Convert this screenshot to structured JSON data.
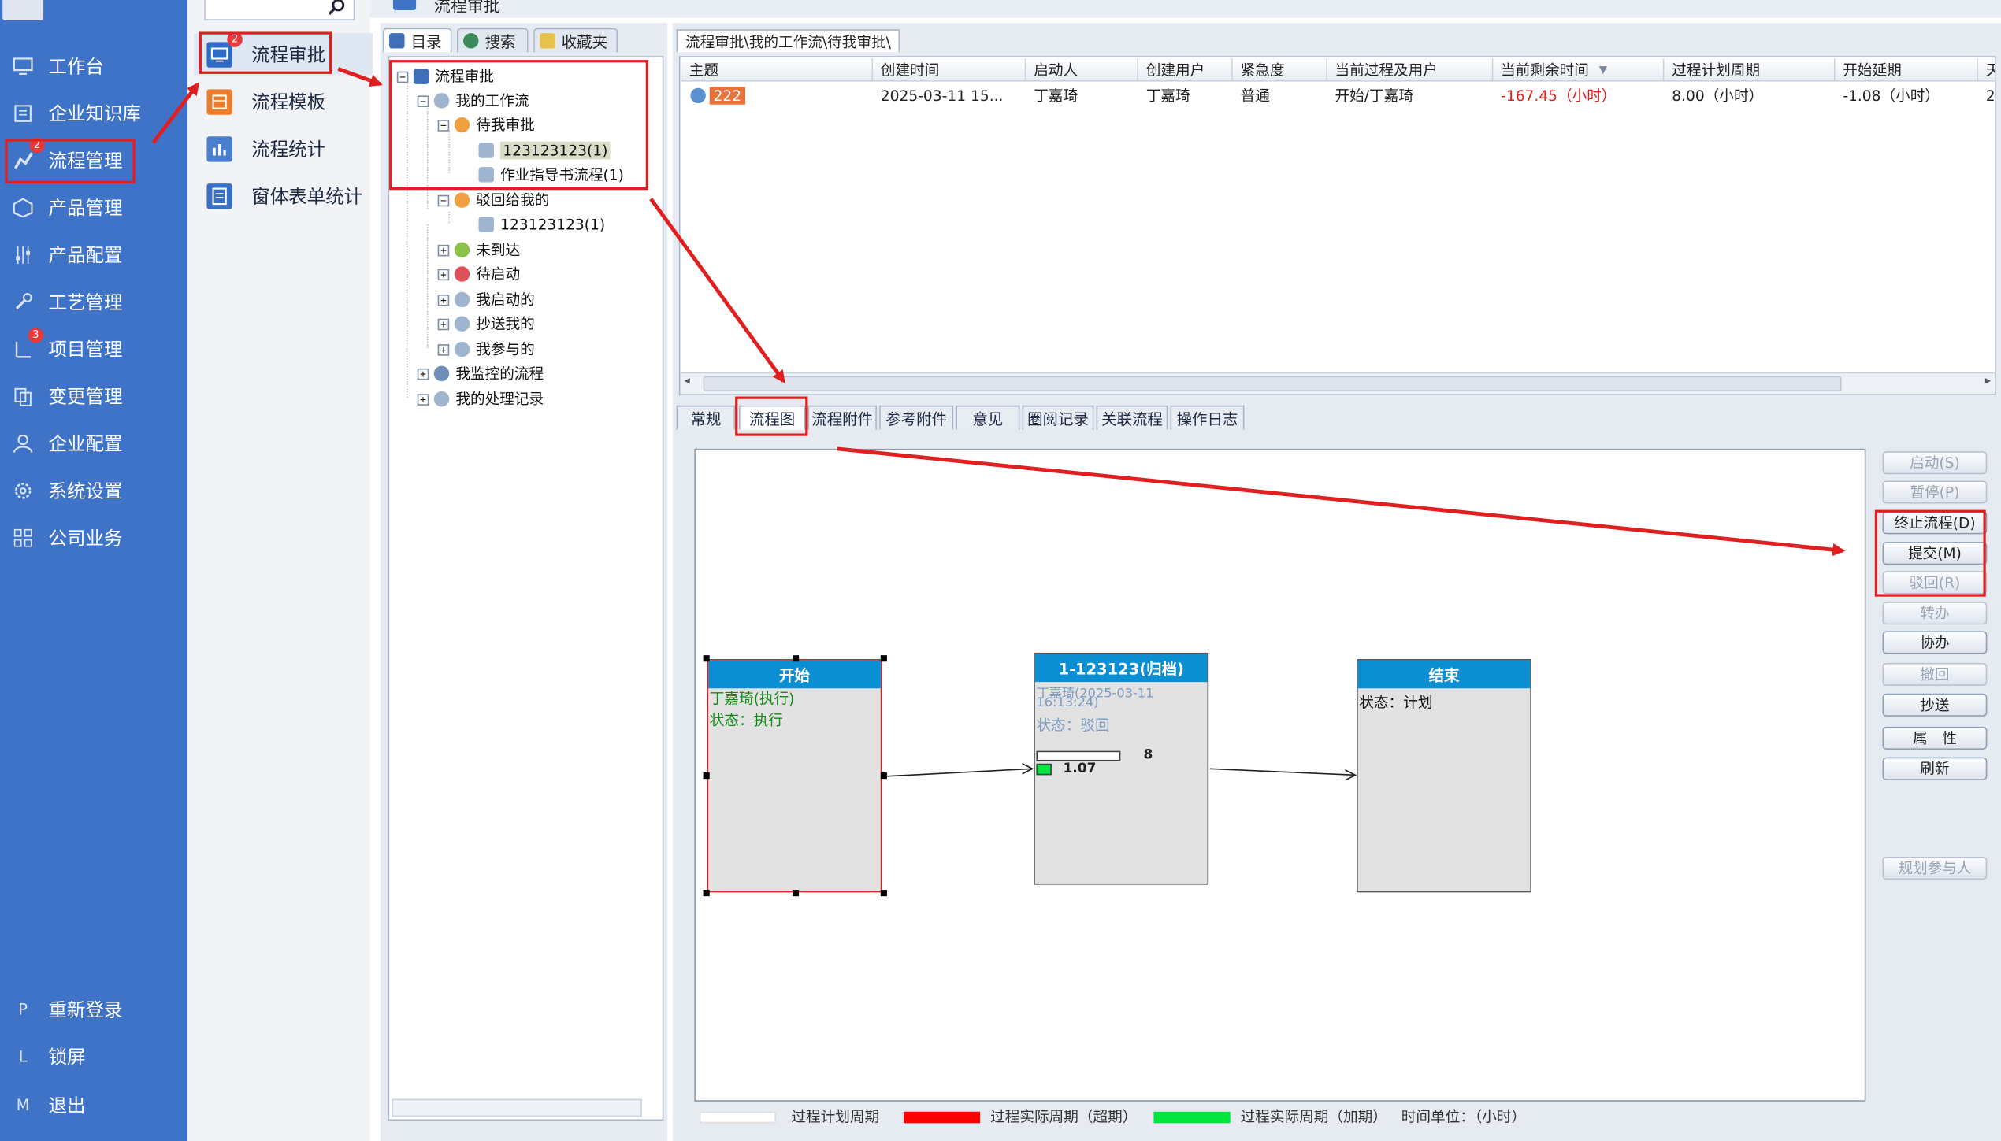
{
  "window": {
    "title": "流程审批"
  },
  "sidebar": {
    "items": [
      {
        "label": "工作台",
        "icon": "monitor-icon"
      },
      {
        "label": "企业知识库",
        "icon": "book-icon"
      },
      {
        "label": "流程管理",
        "icon": "flow-icon",
        "badge": "2"
      },
      {
        "label": "产品管理",
        "icon": "cube-icon"
      },
      {
        "label": "产品配置",
        "icon": "sliders-icon"
      },
      {
        "label": "工艺管理",
        "icon": "wrench-icon"
      },
      {
        "label": "项目管理",
        "icon": "project-icon",
        "badge": "3"
      },
      {
        "label": "变更管理",
        "icon": "change-icon"
      },
      {
        "label": "企业配置",
        "icon": "users-icon"
      },
      {
        "label": "系统设置",
        "icon": "gear-icon"
      },
      {
        "label": "公司业务",
        "icon": "grid-icon"
      }
    ],
    "bottom": [
      {
        "key": "P",
        "label": "重新登录"
      },
      {
        "key": "L",
        "label": "锁屏"
      },
      {
        "key": "M",
        "label": "退出"
      }
    ]
  },
  "submenu": {
    "items": [
      {
        "label": "流程审批",
        "badge": "2"
      },
      {
        "label": "流程模板"
      },
      {
        "label": "流程统计"
      },
      {
        "label": "窗体表单统计"
      }
    ]
  },
  "tree_tabs": [
    "目录",
    "搜索",
    "收藏夹"
  ],
  "tree": [
    {
      "label": "流程审批"
    },
    {
      "label": "我的工作流"
    },
    {
      "label": "待我审批"
    },
    {
      "label": "123123123(1)"
    },
    {
      "label": "作业指导书流程(1)"
    },
    {
      "label": "驳回给我的"
    },
    {
      "label": "123123123(1)"
    },
    {
      "label": "未到达"
    },
    {
      "label": "待启动"
    },
    {
      "label": "我启动的"
    },
    {
      "label": "抄送我的"
    },
    {
      "label": "我参与的"
    },
    {
      "label": "我监控的流程"
    },
    {
      "label": "我的处理记录"
    }
  ],
  "path_tab": "流程审批\\我的工作流\\待我审批\\",
  "grid": {
    "headers": [
      "主题",
      "创建时间",
      "启动人",
      "创建用户",
      "紧急度",
      "当前过程及用户",
      "当前剩余时间",
      "过程计划周期",
      "开始延期",
      "天"
    ],
    "rows": [
      [
        "222",
        "2025-03-11 15...",
        "丁嘉琦",
        "丁嘉琦",
        "普通",
        "开始/丁嘉琦",
        "-167.45（小时）",
        "8.00（小时）",
        "-1.08（小时）",
        "2"
      ]
    ]
  },
  "bottom_tabs": [
    "常规",
    "流程图",
    "流程附件",
    "参考附件",
    "意见",
    "圈阅记录",
    "关联流程",
    "操作日志"
  ],
  "flow": {
    "start": {
      "title": "开始",
      "user": "丁嘉琦(执行)",
      "status": "状态：执行"
    },
    "mid": {
      "title": "1-123123(归档)",
      "user": "丁嘉琦(2025-03-11",
      "time": "16:13:24)",
      "status": "状态：驳回",
      "plan_value": "8",
      "actual_value": "1.07"
    },
    "end": {
      "title": "结束",
      "status": "状态：计划"
    }
  },
  "actions": [
    {
      "label": "启动(S)",
      "enabled": false
    },
    {
      "label": "暂停(P)",
      "enabled": false
    },
    {
      "label": "终止流程(D)",
      "enabled": true
    },
    {
      "label": "提交(M)",
      "enabled": true
    },
    {
      "label": "驳回(R)",
      "enabled": false
    },
    {
      "label": "转办",
      "enabled": false
    },
    {
      "label": "协办",
      "enabled": true
    },
    {
      "label": "撤回",
      "enabled": false
    },
    {
      "label": "抄送",
      "enabled": true
    },
    {
      "label": "属　性",
      "enabled": true
    },
    {
      "label": "刷新",
      "enabled": true
    },
    {
      "label": "规划参与人",
      "enabled": false
    }
  ],
  "legend": {
    "plan": "过程计划周期",
    "overdue": "过程实际周期（超期）",
    "ahead": "过程实际周期（加期）",
    "unit": "时间单位：（小时）"
  },
  "colors": {
    "sidebar": "#3f73c8",
    "node_header": "#0b8fd3",
    "overdue": "#ff0000",
    "ahead": "#00e640",
    "highlight": "#e02020"
  }
}
